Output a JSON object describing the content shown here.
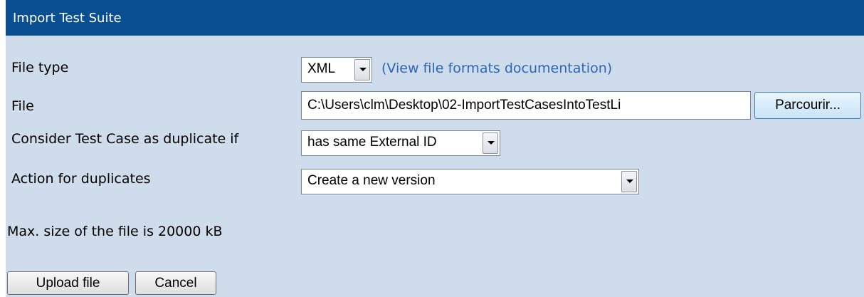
{
  "window": {
    "title": "Import Test Suite"
  },
  "form": {
    "file_type_label": "File type",
    "file_type_value": "XML",
    "docs_link": "(View file formats documentation)",
    "file_label": "File",
    "file_value": "C:\\Users\\clm\\Desktop\\02-ImportTestCasesIntoTestLi",
    "browse_label": "Parcourir...",
    "duplicate_label": "Consider Test Case as duplicate if",
    "duplicate_value": "has same External ID",
    "action_label": "Action for duplicates",
    "action_value": "Create a new version",
    "max_size_text": "Max. size of the file is 20000 kB"
  },
  "buttons": {
    "upload_label": "Upload file",
    "cancel_label": "Cancel"
  },
  "colors": {
    "titlebar": "#0b4f93",
    "background": "#cfdcec",
    "link": "#2d66b8"
  }
}
